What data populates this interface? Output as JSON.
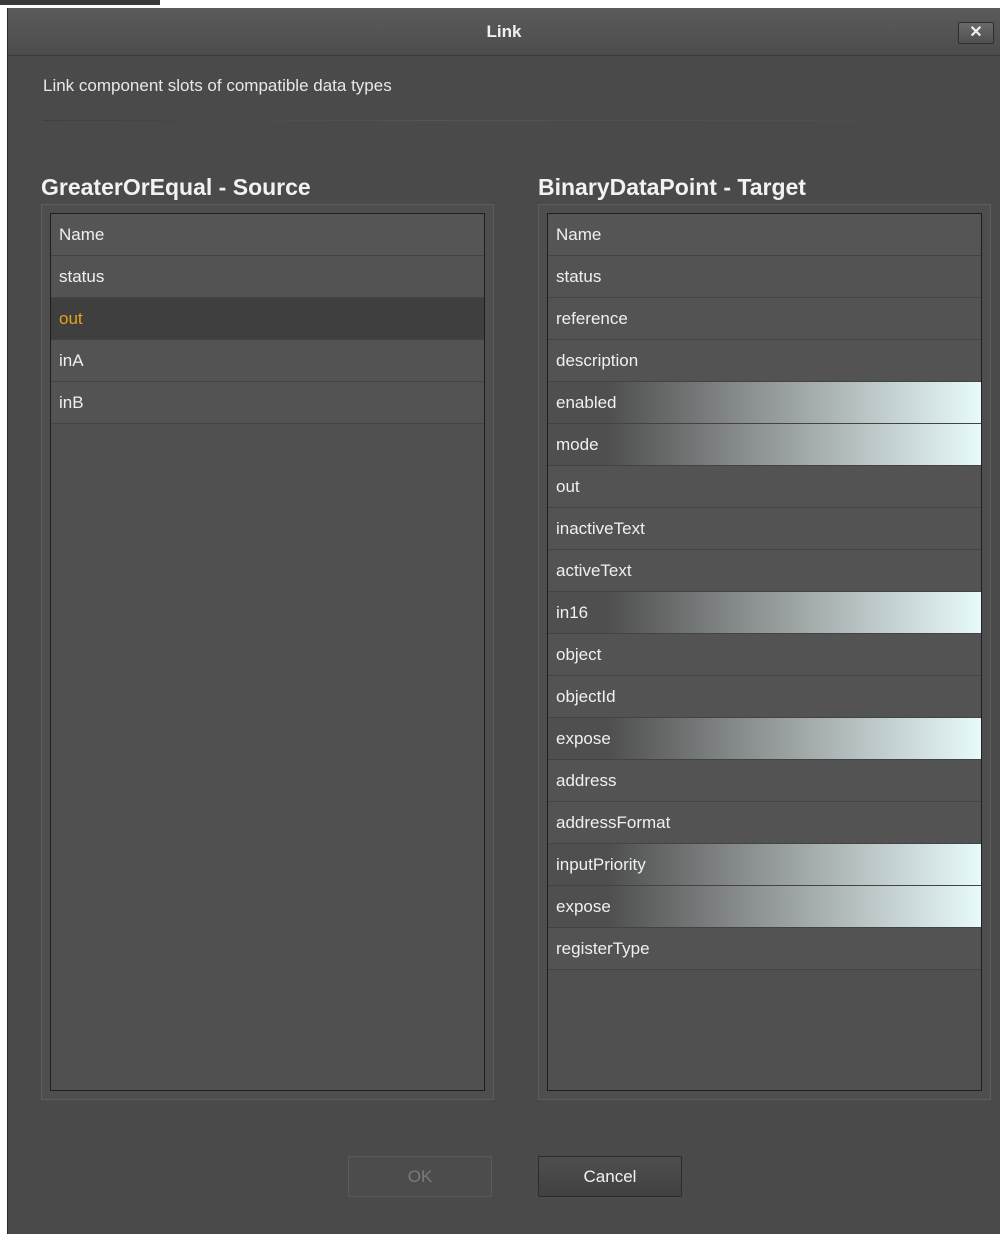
{
  "window": {
    "title": "Link",
    "close_glyph": "✕"
  },
  "subtitle": "Link component slots of compatible data types",
  "source": {
    "heading": "GreaterOrEqual - Source",
    "column_header": "Name",
    "rows": [
      {
        "label": "status",
        "state": "normal"
      },
      {
        "label": "out",
        "state": "selected"
      },
      {
        "label": "inA",
        "state": "normal"
      },
      {
        "label": "inB",
        "state": "normal"
      }
    ]
  },
  "target": {
    "heading": "BinaryDataPoint - Target",
    "column_header": "Name",
    "rows": [
      {
        "label": "status",
        "state": "normal"
      },
      {
        "label": "reference",
        "state": "normal"
      },
      {
        "label": "description",
        "state": "normal"
      },
      {
        "label": "enabled",
        "state": "compatible"
      },
      {
        "label": "mode",
        "state": "compatible"
      },
      {
        "label": "out",
        "state": "normal"
      },
      {
        "label": "inactiveText",
        "state": "normal"
      },
      {
        "label": "activeText",
        "state": "normal"
      },
      {
        "label": "in16",
        "state": "compatible"
      },
      {
        "label": "object",
        "state": "normal"
      },
      {
        "label": "objectId",
        "state": "normal"
      },
      {
        "label": "expose",
        "state": "compatible"
      },
      {
        "label": "address",
        "state": "normal"
      },
      {
        "label": "addressFormat",
        "state": "normal"
      },
      {
        "label": "inputPriority",
        "state": "compatible"
      },
      {
        "label": "expose",
        "state": "compatible"
      },
      {
        "label": "registerType",
        "state": "normal"
      }
    ]
  },
  "buttons": {
    "ok_label": "OK",
    "ok_enabled": false,
    "cancel_label": "Cancel"
  },
  "colors": {
    "selected_text": "#e8a117",
    "compatible_highlight_end": "#e8fafb",
    "dialog_background": "#4a4a4a"
  }
}
